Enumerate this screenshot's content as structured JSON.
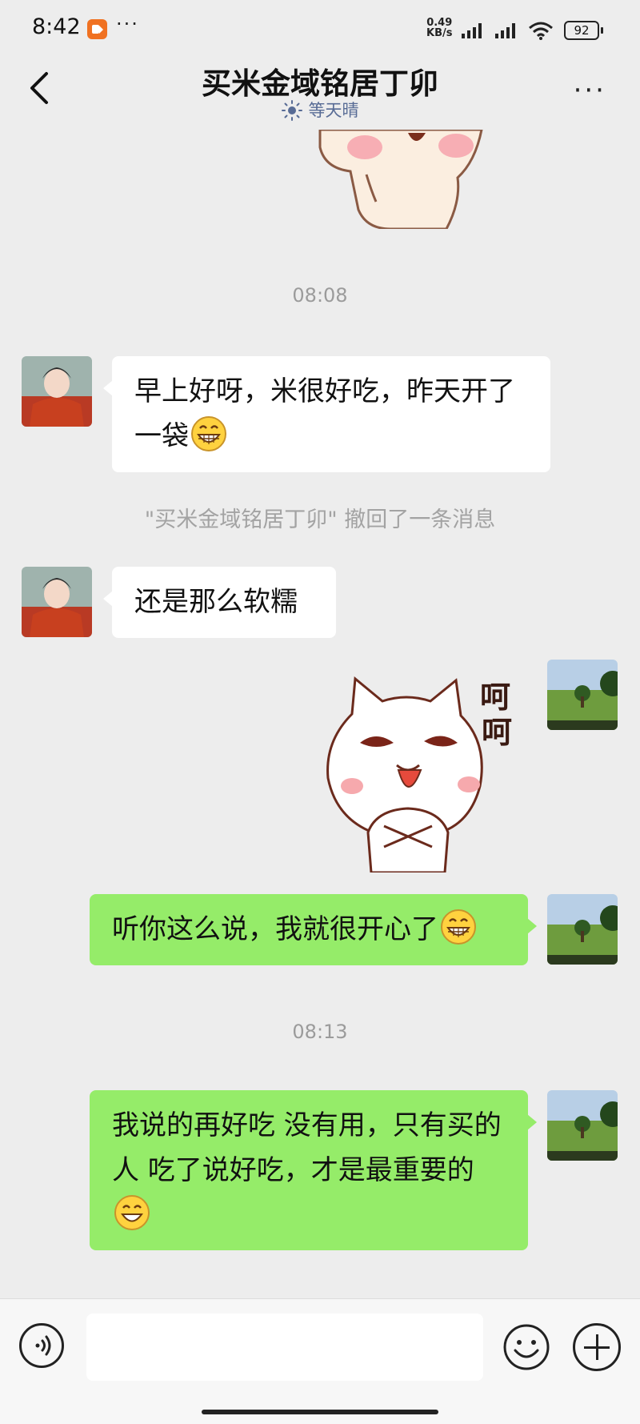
{
  "status_bar": {
    "time": "8:42",
    "more": "···",
    "net_speed_value": "0.49",
    "net_speed_unit": "KB/s",
    "battery": "92",
    "recorder_icon": "screen-record-icon",
    "signal_icon": "signal-icon",
    "wifi_icon": "wifi-icon"
  },
  "header": {
    "title": "买米金域铭居丁卯",
    "subtitle": "等天晴",
    "subtitle_icon": "sun-icon",
    "back_icon": "chevron-left-icon",
    "more_icon": "more-icon",
    "more": "···"
  },
  "messages": {
    "time_1": "08:08",
    "msg_1": "早上好呀，米很好吃，昨天开了一袋",
    "recall_notice": "\"买米金域铭居丁卯\" 撤回了一条消息",
    "msg_2": "还是那么软糯",
    "sticker_text_1": "呵",
    "sticker_text_2": "呵",
    "msg_3": "听你这么说，我就很开心了",
    "time_2": "08:13",
    "msg_4": "我说的再好吃 没有用，只有买的人 吃了说好吃，才是最重要的"
  },
  "input_bar": {
    "placeholder": "",
    "voice_icon": "voice-icon",
    "emoji_icon": "emoji-icon",
    "plus_icon": "plus-icon"
  },
  "colors": {
    "background": "#ededed",
    "sent_bubble": "#95ec69",
    "received_bubble": "#ffffff",
    "subtitle": "#576b95",
    "recorder": "#f07121"
  }
}
